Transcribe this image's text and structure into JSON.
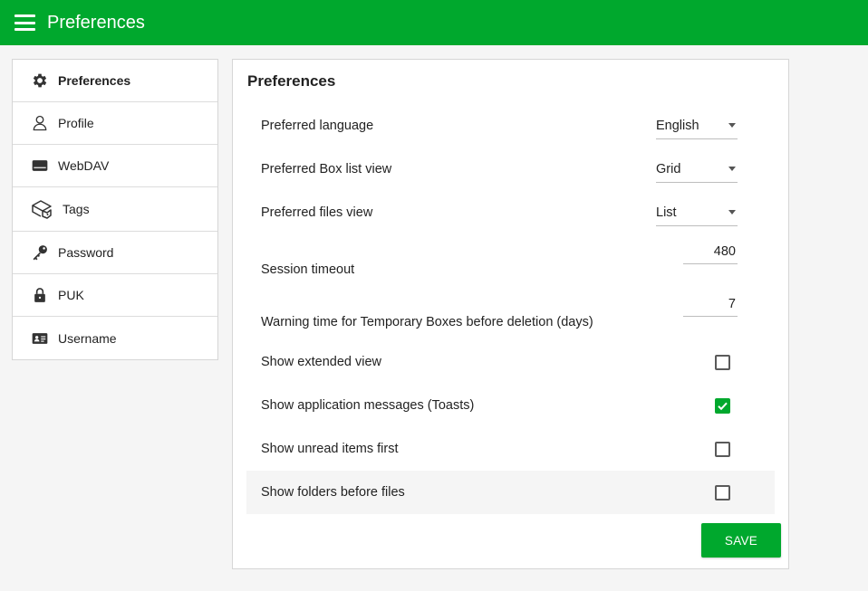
{
  "header": {
    "title": "Preferences",
    "menu_icon": "hamburger-icon",
    "color": "#00a82d"
  },
  "sidebar": {
    "items": [
      {
        "label": "Preferences",
        "icon": "gear-icon",
        "active": true
      },
      {
        "label": "Profile",
        "icon": "user-icon"
      },
      {
        "label": "WebDAV",
        "icon": "drive-icon"
      },
      {
        "label": "Tags",
        "icon": "tag-icon"
      },
      {
        "label": "Password",
        "icon": "key-icon"
      },
      {
        "label": "PUK",
        "icon": "lock-icon"
      },
      {
        "label": "Username",
        "icon": "id-card-icon"
      }
    ]
  },
  "panel": {
    "title": "Preferences",
    "language": {
      "label": "Preferred language",
      "value": "English"
    },
    "box_list_view": {
      "label": "Preferred Box list view",
      "value": "Grid"
    },
    "files_view": {
      "label": "Preferred files view",
      "value": "List"
    },
    "session_timeout": {
      "label": "Session timeout",
      "value": "480"
    },
    "warning_time": {
      "label": "Warning time for Temporary Boxes before deletion (days)",
      "value": "7"
    },
    "extended_view": {
      "label": "Show extended view",
      "checked": false
    },
    "toasts": {
      "label": "Show application messages (Toasts)",
      "checked": true
    },
    "unread_first": {
      "label": "Show unread items first",
      "checked": false
    },
    "folders_first": {
      "label": "Show folders before files",
      "checked": false
    },
    "save_label": "SAVE"
  }
}
